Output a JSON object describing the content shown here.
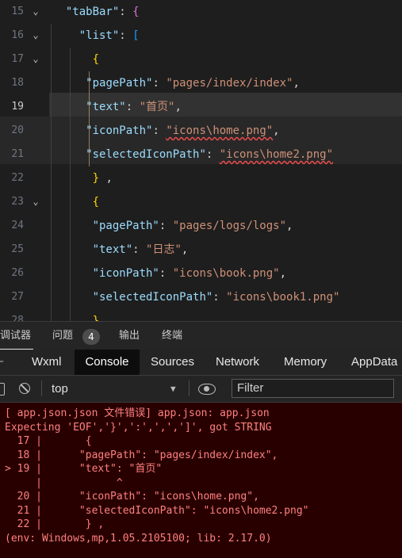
{
  "editor": {
    "lines": [
      {
        "num": "15",
        "fold": true,
        "parts": [
          {
            "t": "  ",
            "c": "p"
          },
          {
            "t": "\"tabBar\"",
            "c": "k"
          },
          {
            "t": ": ",
            "c": "p"
          },
          {
            "t": "{",
            "c": "b2"
          }
        ]
      },
      {
        "num": "16",
        "fold": true,
        "parts": [
          {
            "t": "    ",
            "c": "p"
          },
          {
            "t": "\"list\"",
            "c": "k"
          },
          {
            "t": ": ",
            "c": "p"
          },
          {
            "t": "[",
            "c": "b3"
          }
        ]
      },
      {
        "num": "17",
        "fold": true,
        "parts": [
          {
            "t": "      ",
            "c": "p"
          },
          {
            "t": "{",
            "c": "b1"
          }
        ]
      },
      {
        "num": "18",
        "fold": false,
        "parts": [
          {
            "t": "     ",
            "c": "p"
          },
          {
            "t": "\"pagePath\"",
            "c": "k"
          },
          {
            "t": ": ",
            "c": "p"
          },
          {
            "t": "\"pages/index/index\"",
            "c": "s"
          },
          {
            "t": ",",
            "c": "p"
          }
        ]
      },
      {
        "num": "19",
        "fold": false,
        "parts": [
          {
            "t": "     ",
            "c": "p"
          },
          {
            "t": "\"text\"",
            "c": "k"
          },
          {
            "t": ": ",
            "c": "p"
          },
          {
            "t": "\"首页\"",
            "c": "s"
          },
          {
            "t": ",",
            "c": "p"
          }
        ]
      },
      {
        "num": "20",
        "fold": false,
        "parts": [
          {
            "t": "     ",
            "c": "p"
          },
          {
            "t": "\"iconPath\"",
            "c": "k"
          },
          {
            "t": ": ",
            "c": "p"
          },
          {
            "t": "\"icons\\home.png\"",
            "c": "s sq"
          },
          {
            "t": ",",
            "c": "p"
          }
        ]
      },
      {
        "num": "21",
        "fold": false,
        "parts": [
          {
            "t": "     ",
            "c": "p"
          },
          {
            "t": "\"selectedIconPath\"",
            "c": "k"
          },
          {
            "t": ": ",
            "c": "p"
          },
          {
            "t": "\"icons\\home2.png\"",
            "c": "s sq"
          }
        ]
      },
      {
        "num": "22",
        "fold": false,
        "parts": [
          {
            "t": "      ",
            "c": "p"
          },
          {
            "t": "}",
            "c": "b1"
          },
          {
            "t": " ,",
            "c": "p"
          }
        ]
      },
      {
        "num": "23",
        "fold": true,
        "parts": [
          {
            "t": "      ",
            "c": "p"
          },
          {
            "t": "{",
            "c": "b1"
          }
        ]
      },
      {
        "num": "24",
        "fold": false,
        "parts": [
          {
            "t": "      ",
            "c": "p"
          },
          {
            "t": "\"pagePath\"",
            "c": "k"
          },
          {
            "t": ": ",
            "c": "p"
          },
          {
            "t": "\"pages/logs/logs\"",
            "c": "s"
          },
          {
            "t": ",",
            "c": "p"
          }
        ]
      },
      {
        "num": "25",
        "fold": false,
        "parts": [
          {
            "t": "      ",
            "c": "p"
          },
          {
            "t": "\"text\"",
            "c": "k"
          },
          {
            "t": ": ",
            "c": "p"
          },
          {
            "t": "\"日志\"",
            "c": "s"
          },
          {
            "t": ",",
            "c": "p"
          }
        ]
      },
      {
        "num": "26",
        "fold": false,
        "parts": [
          {
            "t": "      ",
            "c": "p"
          },
          {
            "t": "\"iconPath\"",
            "c": "k"
          },
          {
            "t": ": ",
            "c": "p"
          },
          {
            "t": "\"icons\\book.png\"",
            "c": "s"
          },
          {
            "t": ",",
            "c": "p"
          }
        ]
      },
      {
        "num": "27",
        "fold": false,
        "parts": [
          {
            "t": "      ",
            "c": "p"
          },
          {
            "t": "\"selectedIconPath\"",
            "c": "k"
          },
          {
            "t": ": ",
            "c": "p"
          },
          {
            "t": "\"icons\\book1.png\"",
            "c": "s"
          }
        ]
      },
      {
        "num": "28",
        "fold": false,
        "parts": [
          {
            "t": "      ",
            "c": "p"
          },
          {
            "t": "}",
            "c": "b1"
          }
        ]
      }
    ],
    "current_line": "19"
  },
  "panel_tabs": {
    "debugger": "调试器",
    "problems": "问题",
    "problems_count": "4",
    "output": "输出",
    "terminal": "终端"
  },
  "devtools_tabs": {
    "wxml": "Wxml",
    "console": "Console",
    "sources": "Sources",
    "network": "Network",
    "memory": "Memory",
    "appdata": "AppData"
  },
  "toolbar": {
    "context": "top",
    "filter_placeholder": "Filter"
  },
  "console": {
    "lines": [
      "[ app.json.json 文件错误] app.json: app.json",
      "Expecting 'EOF','}',':',',',']', got STRING",
      "  17 |       {",
      "  18 |      \"pagePath\": \"pages/index/index\",",
      "> 19 |      \"text\": \"首页\"",
      "     |            ^",
      "  20 |      \"iconPath\": \"icons\\home.png\",",
      "  21 |      \"selectedIconPath\": \"icons\\home2.png\"",
      "  22 |       } ,",
      "(env: Windows,mp,1.05.2105100; lib: 2.17.0)"
    ]
  },
  "colors": {
    "editor_bg": "#1e1e1e",
    "console_bg": "#290000",
    "error_text": "#ff8080",
    "key": "#9cdcfe",
    "string": "#ce9178"
  }
}
